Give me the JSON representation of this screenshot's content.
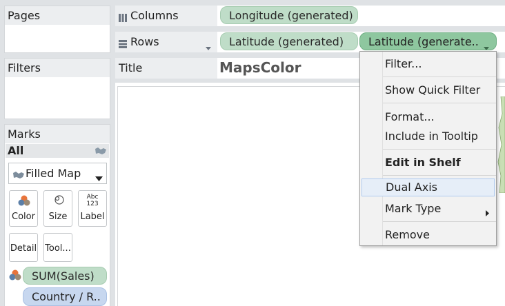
{
  "panels": {
    "pages_label": "Pages",
    "filters_label": "Filters",
    "marks_label": "Marks"
  },
  "marks": {
    "all_label": "All",
    "mark_type": "Filled Map",
    "buttons": {
      "color": "Color",
      "size": "Size",
      "label": "Label",
      "label_icon_text": "Abc\n123",
      "detail": "Detail",
      "tooltip": "Tool..."
    },
    "fields": {
      "sum_sales": "SUM(Sales)",
      "country": "Country / R.."
    }
  },
  "shelves": {
    "columns_label": "Columns",
    "rows_label": "Rows",
    "columns_pill": "Longitude (generated)",
    "rows_pill_1": "Latitude (generated)",
    "rows_pill_2": "Latitude (generate.."
  },
  "title": {
    "label": "Title",
    "text": "MapsColor"
  },
  "context_menu": {
    "items": {
      "filter": "Filter...",
      "show_quick_filter": "Show Quick Filter",
      "format": "Format...",
      "include_in_tooltip": "Include in Tooltip",
      "edit_in_shelf": "Edit in Shelf",
      "dual_axis": "Dual Axis",
      "mark_type": "Mark Type",
      "remove": "Remove"
    }
  },
  "icons": {
    "grid": "grid-icon",
    "rows": "rows-icon",
    "map": "map-icon",
    "color": "color-icon",
    "size": "size-icon",
    "dropdown": "dropdown-arrow-icon",
    "submenu": "submenu-arrow-icon"
  },
  "colors": {
    "pill_green": "#bfddc8",
    "pill_green_active": "#8ec79f",
    "pill_blue": "#c7d7ef",
    "menu_highlight": "#e6eef8",
    "map_land": "#c9dfb4"
  }
}
